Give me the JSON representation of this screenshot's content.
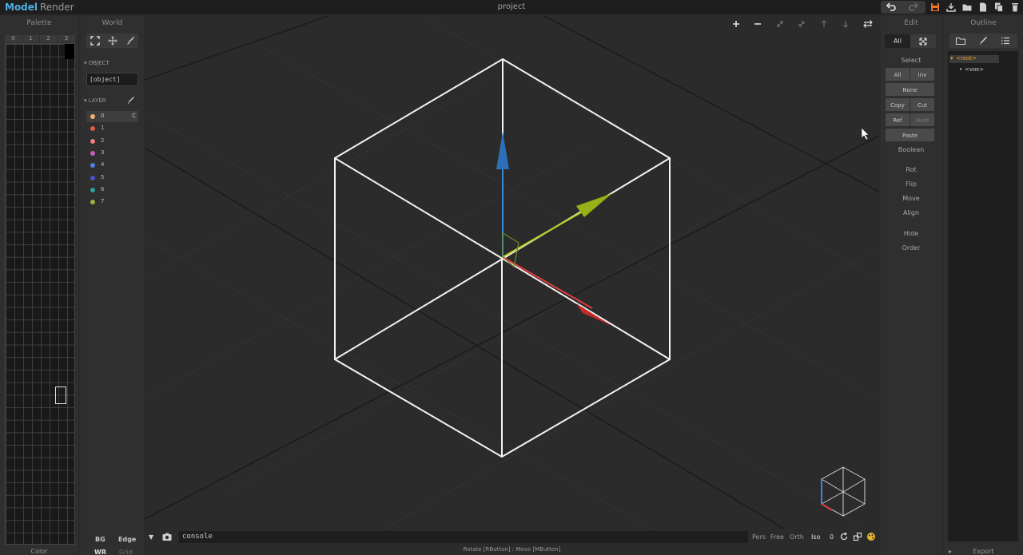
{
  "topbar": {
    "mode_model": "Model",
    "mode_render": "Render",
    "doc_title": "project",
    "icons": [
      "undo-icon",
      "redo-icon",
      "save-icon",
      "export-icon",
      "open-icon",
      "new-icon",
      "copy-icon",
      "delete-icon"
    ]
  },
  "palette": {
    "title": "Palette",
    "tabs": [
      "0",
      "1",
      "2",
      "3"
    ],
    "footer": "Color"
  },
  "world": {
    "title": "World",
    "object_header": "▾ OBJECT",
    "object_name": "[object]",
    "layer_header": "▾ LAYER",
    "layers": [
      {
        "label": "0",
        "color": "#f0b070"
      },
      {
        "label": "1",
        "color": "#e05a4c"
      },
      {
        "label": "2",
        "color": "#f08080"
      },
      {
        "label": "3",
        "color": "#c060c0"
      },
      {
        "label": "4",
        "color": "#5080e0"
      },
      {
        "label": "5",
        "color": "#5050c8"
      },
      {
        "label": "6",
        "color": "#30a0a0"
      },
      {
        "label": "7",
        "color": "#a0b040"
      }
    ],
    "active_layer_vis": "C",
    "bg_label": "BG",
    "edge_label": "Edge",
    "wr_label": "WR",
    "grid_label": "Grid"
  },
  "viewport": {
    "console_value": "console",
    "view_modes": [
      "Pers",
      "Free",
      "Orth",
      "Iso"
    ],
    "zoom_value": "0",
    "status": "Rotate [RButton] : Move [MButton]",
    "colors": {
      "x_axis": "#e03c3c",
      "y_axis": "#b8d020",
      "z_axis": "#3a88d8",
      "box": "#f2f2f2"
    }
  },
  "edit": {
    "title": "Edit",
    "tab_all": "All",
    "select_label": "Select",
    "btn_all": "All",
    "btn_inv": "Inv",
    "btn_none": "None",
    "btn_copy": "Copy",
    "btn_cut": "Cut",
    "btn_ref": "Ref",
    "btn_hold": "Hold",
    "btn_paste": "Paste",
    "boolean": "Boolean",
    "rot": "Rot",
    "flip": "Flip",
    "move": "Move",
    "align": "Align",
    "hide": "Hide",
    "order": "Order"
  },
  "outline": {
    "title": "Outline",
    "root": "<root>",
    "child": "<vox>",
    "export": "Export"
  }
}
